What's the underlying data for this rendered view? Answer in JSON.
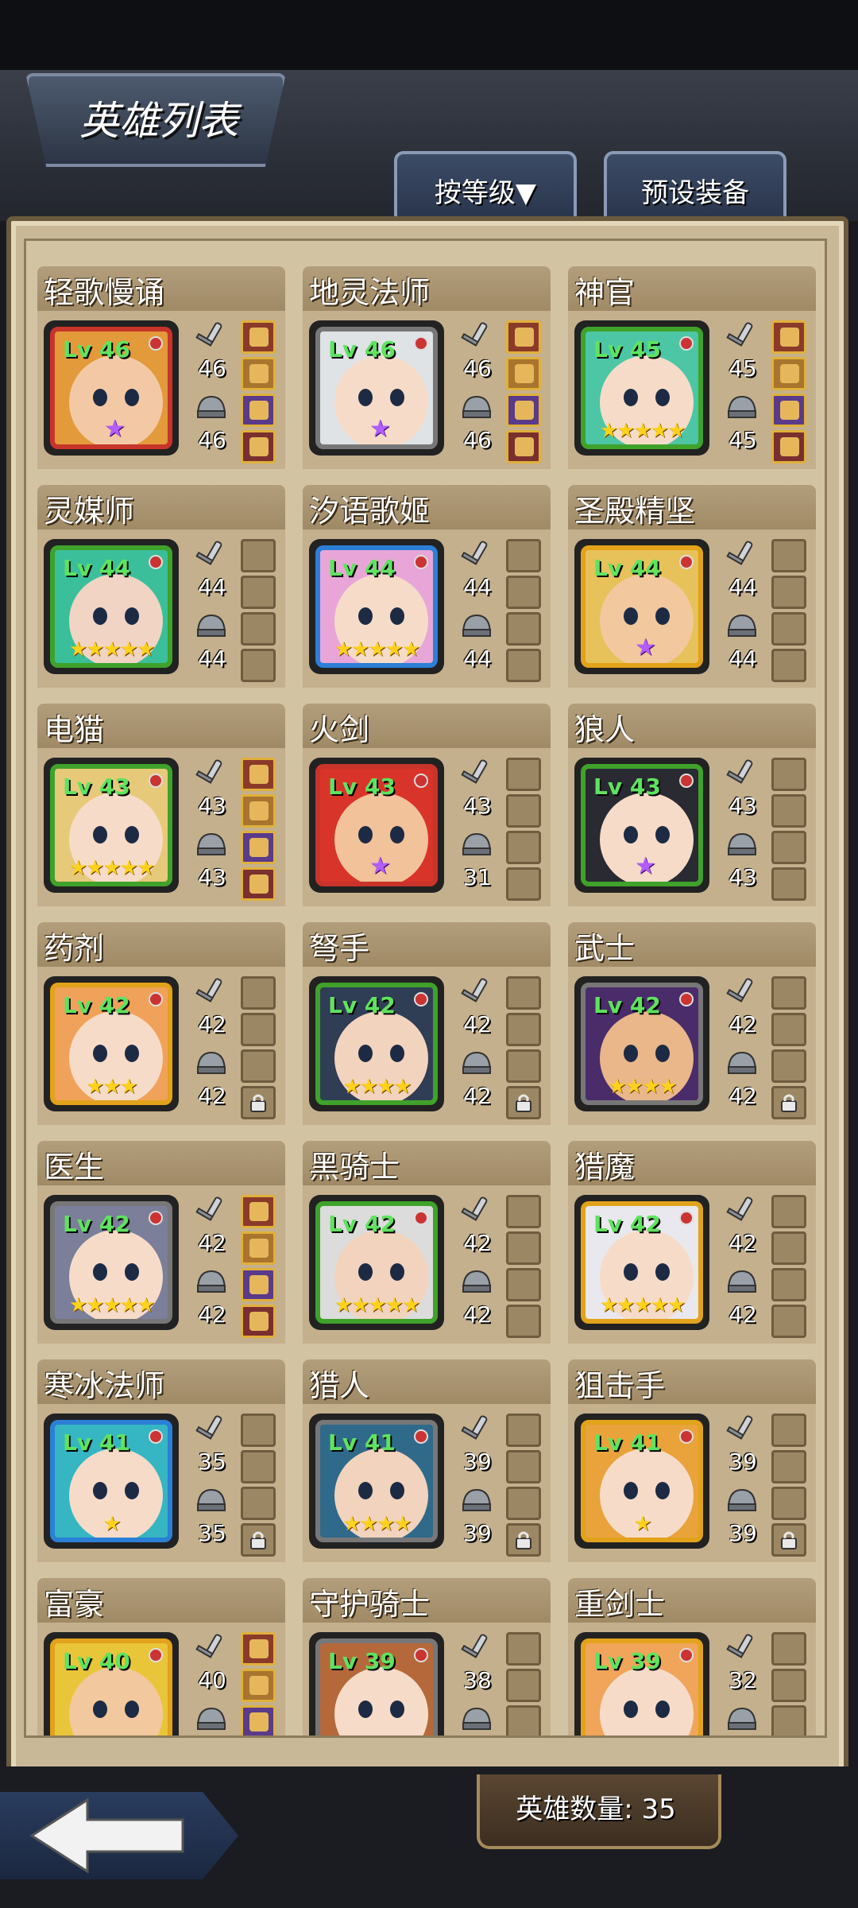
{
  "header": {
    "title": "英雄列表"
  },
  "tabs": {
    "sort_label": "按等级▼",
    "preset_label": "预设装备"
  },
  "footer": {
    "hero_count": "英雄数量: 35"
  },
  "colors": {
    "green_frame": "#3fa22a",
    "blue_frame": "#2c7fd6",
    "orange_frame": "#e2a21a",
    "red_frame": "#c8342a",
    "gray_frame": "#777777"
  },
  "heroes": [
    {
      "name": "轻歌慢诵",
      "level": "Lv 46",
      "weapon": "46",
      "armor": "46",
      "stars": "",
      "star_badge": "purple",
      "frame": "#c8342a",
      "face": "#f3c9a5",
      "hair": "#e39a3a",
      "slots": [
        "filled",
        "filled",
        "filled",
        "filled"
      ],
      "locked": false
    },
    {
      "name": "地灵法师",
      "level": "Lv 46",
      "weapon": "46",
      "armor": "46",
      "stars": "",
      "star_badge": "purple",
      "frame": "#777777",
      "face": "#f6dcc8",
      "hair": "#dfe3e6",
      "slots": [
        "filled",
        "filled",
        "filled",
        "filled"
      ],
      "locked": false
    },
    {
      "name": "神官",
      "level": "Lv 45",
      "weapon": "45",
      "armor": "45",
      "stars": "★★★★★",
      "star_badge": "",
      "frame": "#3fa22a",
      "face": "#f6dcc8",
      "hair": "#4cc6a5",
      "slots": [
        "filled",
        "filled",
        "filled",
        "filled"
      ],
      "locked": false
    },
    {
      "name": "灵媒师",
      "level": "Lv 44",
      "weapon": "44",
      "armor": "44",
      "stars": "★★★★★",
      "star_badge": "",
      "frame": "#3fa22a",
      "face": "#f1d4c4",
      "hair": "#3bbf9a",
      "slots": [
        "empty",
        "empty",
        "empty",
        "empty"
      ],
      "locked": false
    },
    {
      "name": "汐语歌姬",
      "level": "Lv 44",
      "weapon": "44",
      "armor": "44",
      "stars": "★★★★★",
      "star_badge": "",
      "frame": "#2c7fd6",
      "face": "#f6dcc8",
      "hair": "#e8a6d8",
      "slots": [
        "empty",
        "empty",
        "empty",
        "empty"
      ],
      "locked": false
    },
    {
      "name": "圣殿精坚",
      "level": "Lv 44",
      "weapon": "44",
      "armor": "44",
      "stars": "",
      "star_badge": "purple",
      "frame": "#e2a21a",
      "face": "#f2c89e",
      "hair": "#e7c25a",
      "slots": [
        "empty",
        "empty",
        "empty",
        "empty"
      ],
      "locked": false
    },
    {
      "name": "电猫",
      "level": "Lv 43",
      "weapon": "43",
      "armor": "43",
      "stars": "★★★★★",
      "star_badge": "",
      "frame": "#3fa22a",
      "face": "#f6dcc8",
      "hair": "#e7c97a",
      "slots": [
        "filled",
        "filled",
        "filled",
        "filled"
      ],
      "locked": false
    },
    {
      "name": "火剑",
      "level": "Lv 43",
      "weapon": "43",
      "armor": "31",
      "stars": "",
      "star_badge": "purple",
      "frame": "#c8342a",
      "face": "#f2c29a",
      "hair": "#d9342a",
      "slots": [
        "empty",
        "empty",
        "empty",
        "empty"
      ],
      "locked": false
    },
    {
      "name": "狼人",
      "level": "Lv 43",
      "weapon": "43",
      "armor": "43",
      "stars": "",
      "star_badge": "purple",
      "frame": "#3fa22a",
      "face": "#f6dcc8",
      "hair": "#2a2a33",
      "slots": [
        "empty",
        "empty",
        "empty",
        "empty"
      ],
      "locked": false
    },
    {
      "name": "药剂",
      "level": "Lv 42",
      "weapon": "42",
      "armor": "42",
      "stars": "★★★",
      "star_badge": "",
      "frame": "#e2a21a",
      "face": "#f6dcc8",
      "hair": "#f1a25a",
      "slots": [
        "empty",
        "empty",
        "empty",
        "lock"
      ],
      "locked": true
    },
    {
      "name": "弩手",
      "level": "Lv 42",
      "weapon": "42",
      "armor": "42",
      "stars": "★★★★",
      "star_badge": "",
      "frame": "#3fa22a",
      "face": "#f2d3bd",
      "hair": "#2f3d55",
      "slots": [
        "empty",
        "empty",
        "empty",
        "lock"
      ],
      "locked": true
    },
    {
      "name": "武士",
      "level": "Lv 42",
      "weapon": "42",
      "armor": "42",
      "stars": "★★★★",
      "star_badge": "",
      "frame": "#777777",
      "face": "#e9b789",
      "hair": "#4a2c6a",
      "slots": [
        "empty",
        "empty",
        "empty",
        "lock"
      ],
      "locked": true
    },
    {
      "name": "医生",
      "level": "Lv 42",
      "weapon": "42",
      "armor": "42",
      "stars": "★★★★★",
      "star_badge": "",
      "frame": "#777777",
      "face": "#f6dcc8",
      "hair": "#7b7f9a",
      "slots": [
        "filled",
        "filled",
        "filled",
        "filled"
      ],
      "locked": false
    },
    {
      "name": "黑骑士",
      "level": "Lv 42",
      "weapon": "42",
      "armor": "42",
      "stars": "★★★★★",
      "star_badge": "",
      "frame": "#3fa22a",
      "face": "#f2d3bd",
      "hair": "#dcdcdc",
      "slots": [
        "empty",
        "empty",
        "empty",
        "empty"
      ],
      "locked": false
    },
    {
      "name": "猎魔",
      "level": "Lv 42",
      "weapon": "42",
      "armor": "42",
      "stars": "★★★★★",
      "star_badge": "",
      "frame": "#e2a21a",
      "face": "#f6dcc8",
      "hair": "#e8e8ee",
      "slots": [
        "empty",
        "empty",
        "empty",
        "empty"
      ],
      "locked": false
    },
    {
      "name": "寒冰法师",
      "level": "Lv 41",
      "weapon": "35",
      "armor": "35",
      "stars": "★",
      "star_badge": "",
      "frame": "#2c7fd6",
      "face": "#f6dcc8",
      "hair": "#35b6c2",
      "slots": [
        "empty",
        "empty",
        "empty",
        "lock"
      ],
      "locked": true
    },
    {
      "name": "猎人",
      "level": "Lv 41",
      "weapon": "39",
      "armor": "39",
      "stars": "★★★★",
      "star_badge": "",
      "frame": "#777777",
      "face": "#f2d3bd",
      "hair": "#2f6a8a",
      "slots": [
        "empty",
        "empty",
        "empty",
        "lock"
      ],
      "locked": true
    },
    {
      "name": "狙击手",
      "level": "Lv 41",
      "weapon": "39",
      "armor": "39",
      "stars": "★",
      "star_badge": "",
      "frame": "#e2a21a",
      "face": "#f6dcc8",
      "hair": "#e9a33a",
      "slots": [
        "empty",
        "empty",
        "empty",
        "lock"
      ],
      "locked": true
    },
    {
      "name": "富豪",
      "level": "Lv 40",
      "weapon": "40",
      "armor": "",
      "stars": "",
      "star_badge": "",
      "frame": "#e2a21a",
      "face": "#f2c89e",
      "hair": "#e9c53a",
      "slots": [
        "filled",
        "filled",
        "filled",
        "filled"
      ],
      "locked": false
    },
    {
      "name": "守护骑士",
      "level": "Lv 39",
      "weapon": "38",
      "armor": "",
      "stars": "",
      "star_badge": "",
      "frame": "#777777",
      "face": "#f6dcc8",
      "hair": "#b5693a",
      "slots": [
        "empty",
        "empty",
        "empty",
        "empty"
      ],
      "locked": false
    },
    {
      "name": "重剑士",
      "level": "Lv 39",
      "weapon": "32",
      "armor": "",
      "stars": "",
      "star_badge": "",
      "frame": "#e2a21a",
      "face": "#f6dcc8",
      "hair": "#f0a55a",
      "slots": [
        "empty",
        "empty",
        "empty",
        "empty"
      ],
      "locked": false
    }
  ]
}
